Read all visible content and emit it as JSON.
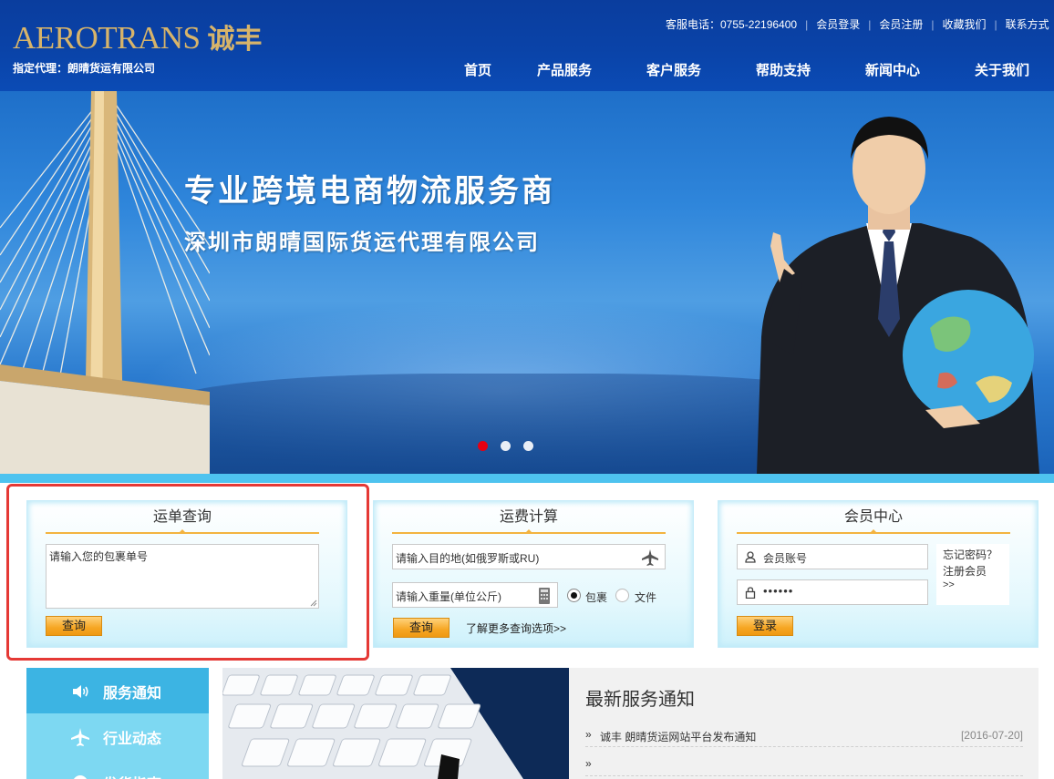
{
  "header": {
    "logo_en": "AEROTRANS",
    "logo_cn": "诚丰",
    "agent": "指定代理：朗晴货运有限公司",
    "toplinks": [
      "客服电话：0755-22196400",
      "会员登录",
      "会员注册",
      "收藏我们",
      "联系方式"
    ],
    "nav": [
      "首页",
      "产品服务",
      "客户服务",
      "帮助支持",
      "新闻中心",
      "关于我们"
    ]
  },
  "banner": {
    "slogan1": "专业跨境电商物流服务商",
    "slogan2": "深圳市朗晴国际货运代理有限公司",
    "dots_total": 3,
    "dots_active": 1
  },
  "tracking": {
    "title": "运单查询",
    "placeholder": "请输入您的包裹单号",
    "button": "查询"
  },
  "freight": {
    "title": "运费计算",
    "dest_placeholder": "请输入目的地(如俄罗斯或RU)",
    "weight_placeholder": "请输入重量(单位公斤)",
    "radio_parcel": "包裹",
    "radio_document": "文件",
    "selected": "包裹",
    "button": "查询",
    "more_link": "了解更多查询选项>>"
  },
  "member": {
    "title": "会员中心",
    "account_placeholder": "会员账号",
    "password_mask": "••••••",
    "forgot": "忘记密码？",
    "register": "注册会员",
    "more": ">>",
    "button": "登录"
  },
  "sidenav": {
    "items": [
      {
        "label": "服务通知",
        "icon": "speaker-icon",
        "active": true
      },
      {
        "label": "行业动态",
        "icon": "airplane-icon",
        "active": false
      },
      {
        "label": "发货指南",
        "icon": "document-icon",
        "active": false
      }
    ]
  },
  "news": {
    "title": "最新服务通知",
    "items": [
      {
        "bullet": "»",
        "text": "诚丰 朗晴货运网站平台发布通知",
        "date": "[2016-07-20]"
      },
      {
        "bullet": "»",
        "text": "",
        "date": ""
      }
    ]
  },
  "colors": {
    "header_bg": "#0a43a8",
    "accent_orange": "#f6a623",
    "panel_cyan": "#4ec3ef",
    "highlight_red": "#e53935"
  }
}
